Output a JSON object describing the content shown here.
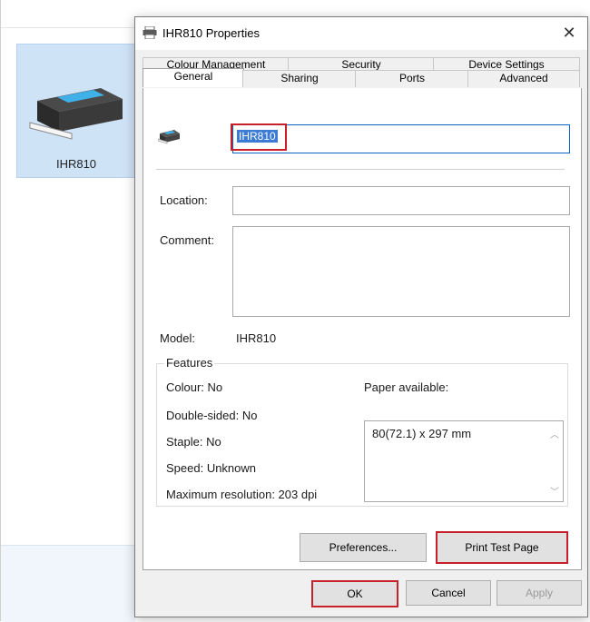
{
  "background": {
    "printer_label": "IHR810"
  },
  "dialog": {
    "title": "IHR810 Properties",
    "close_glyph": "✕",
    "tabs_row1": [
      "Colour Management",
      "Security",
      "Device Settings"
    ],
    "tabs_row2": [
      "General",
      "Sharing",
      "Ports",
      "Advanced"
    ],
    "active_tab": "General",
    "general": {
      "printer_name": "IHR810",
      "location_label": "Location:",
      "location_value": "",
      "comment_label": "Comment:",
      "comment_value": "",
      "model_label": "Model:",
      "model_value": "IHR810",
      "features": {
        "title": "Features",
        "colour": "Colour: No",
        "double_sided": "Double-sided: No",
        "staple": "Staple: No",
        "speed": "Speed: Unknown",
        "max_resolution": "Maximum resolution: 203 dpi",
        "paper_label": "Paper available:",
        "paper_items": [
          "80(72.1) x 297 mm"
        ]
      },
      "preferences_label": "Preferences...",
      "print_test_label": "Print Test Page"
    },
    "footer": {
      "ok_label": "OK",
      "cancel_label": "Cancel",
      "apply_label": "Apply"
    }
  },
  "colors": {
    "highlight_red": "#c8202a",
    "selection_blue": "#3b7bd5",
    "tile_blue": "#cfe3f7"
  }
}
